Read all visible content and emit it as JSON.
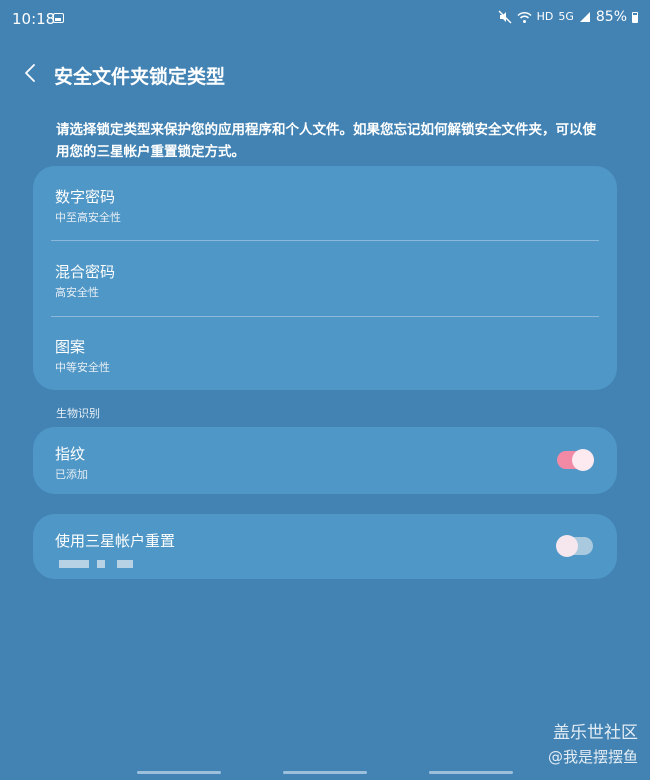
{
  "status_bar": {
    "time": "10:18",
    "battery": "85%",
    "network_hd": "HD",
    "network_5g": "5G"
  },
  "header": {
    "title": "安全文件夹锁定类型"
  },
  "description": "请选择锁定类型来保护您的应用程序和个人文件。如果您忘记如何解锁安全文件夹，可以使用您的三星帐户重置锁定方式。",
  "lock_types": [
    {
      "title": "数字密码",
      "subtitle": "中至高安全性"
    },
    {
      "title": "混合密码",
      "subtitle": "高安全性"
    },
    {
      "title": "图案",
      "subtitle": "中等安全性"
    }
  ],
  "biometrics": {
    "section_label": "生物识别",
    "fingerprint": {
      "title": "指纹",
      "subtitle": "已添加",
      "enabled": true
    }
  },
  "samsung_reset": {
    "title": "使用三星帐户重置",
    "enabled": false
  },
  "watermark": {
    "line1": "盖乐世社区",
    "line2": "@我是摆摆鱼"
  },
  "colors": {
    "background": "#4283b4",
    "card": "#4f97c6",
    "toggle_on": "#f28aa6"
  }
}
